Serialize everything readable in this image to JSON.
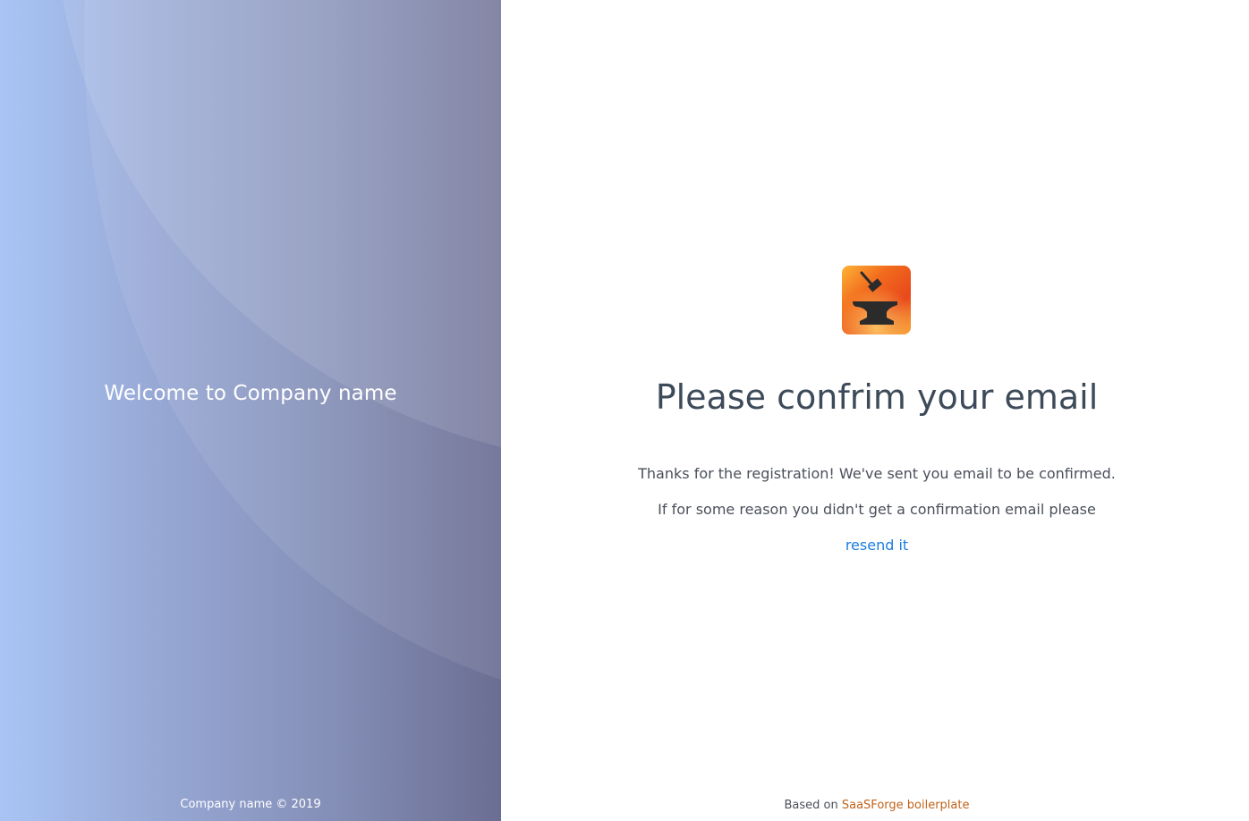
{
  "hero": {
    "title": "Welcome to Company name",
    "footer": "Company name © 2019"
  },
  "logo": {
    "icon": "anvil-hammer-icon",
    "colors": [
      "#f26b1d",
      "#e8491c",
      "#fdb338"
    ]
  },
  "main": {
    "heading": "Please confrim your email",
    "line1": "Thanks for the registration! We've sent you email to be confirmed.",
    "line2": "If for some reason you didn't get a confirmation email please",
    "resend_link": "resend it"
  },
  "footer": {
    "prefix": "Based on",
    "link": "SaaSForge boilerplate"
  },
  "colors": {
    "link": "#1c7ee0",
    "footer_link": "#c0621a",
    "heading": "#3d4a59"
  }
}
